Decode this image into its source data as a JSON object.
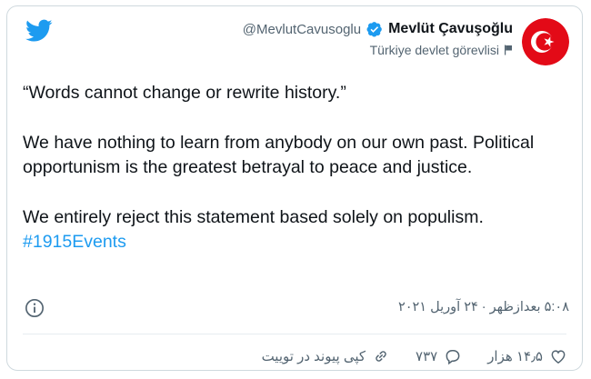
{
  "user": {
    "handle": "@MevlutCavusoglu",
    "display_name": "Mevlüt Çavuşoğlu",
    "label": "Türkiye devlet görevlisi",
    "avatar_icon": "turkish-flag-avatar",
    "verified_icon": "verified-badge-icon",
    "label_icon": "government-flag-icon"
  },
  "brand": {
    "icon": "twitter-bird-icon",
    "color": "#1d9bf0"
  },
  "tweet": {
    "line1": "“Words cannot change or rewrite history.”",
    "line2": "We have nothing to learn from anybody on our own past. Political opportunism is the greatest betrayal to peace and justice.",
    "line3": "We entirely reject this statement based solely on populism.",
    "hashtag": "#1915Events"
  },
  "meta": {
    "timestamp": "۵:۰۸ بعدازظهر · ۲۴ آوریل ۲۰۲۱",
    "info_icon": "info-icon"
  },
  "actions": {
    "like_count": "۱۴٫۵ هزار",
    "reply_count": "۷۳۷",
    "copy_link_label": "کپی پیوند در توییت"
  }
}
